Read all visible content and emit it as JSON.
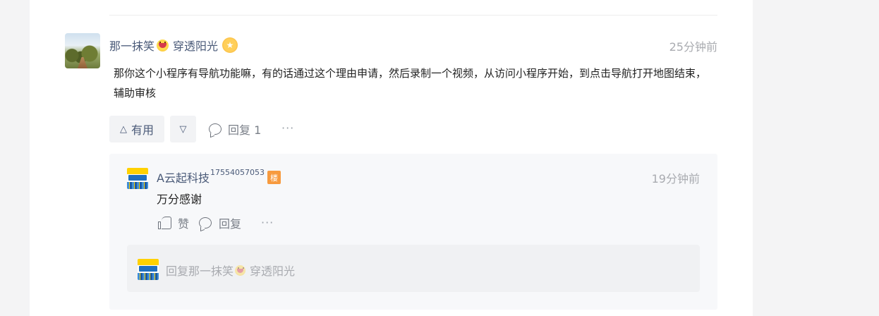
{
  "comment": {
    "author": "那一抹笑",
    "author_suffix": "穿透阳光",
    "emoji_icon": "grinning-face-emoji-icon",
    "badge_icon": "star-medal-icon",
    "time": "25分钟前",
    "content": "那你这个小程序有导航功能嘛，有的话通过这个理由申请，然后录制一个视频，从访问小程序开始，到点击导航打开地图结束，辅助审核",
    "actions": {
      "useful_label": "有用",
      "useful_icon": "△",
      "downvote_icon": "▽",
      "reply_label": "回复 1",
      "more_label": "···"
    }
  },
  "reply": {
    "author": "A云起科技",
    "author_sup": "17554057053",
    "floor_badge": "楼",
    "time": "19分钟前",
    "content": "万分感谢",
    "actions": {
      "like_label": "赞",
      "reply_label": "回复",
      "more_label": "···"
    }
  },
  "reply_editor": {
    "placeholder_prefix": "回复那一抹笑",
    "placeholder_suffix": "穿透阳光"
  },
  "colors": {
    "author_link": "#4a5a78",
    "muted": "#a9abb0",
    "badge_orange": "#f79a3e"
  }
}
